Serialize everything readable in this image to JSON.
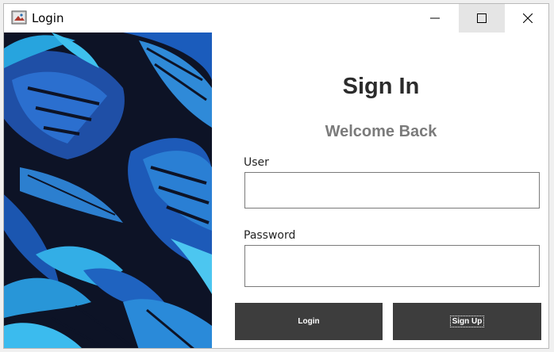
{
  "window": {
    "title": "Login",
    "icons": [
      "app-icon",
      "minimize-icon",
      "maximize-icon",
      "close-icon"
    ]
  },
  "form": {
    "heading": "Sign In",
    "subheading": "Welcome Back",
    "user_label": "User",
    "user_value": "",
    "password_label": "Password",
    "password_value": "",
    "login_button": "Login",
    "signup_button": "Sign Up"
  },
  "colors": {
    "button_bg": "#3d3d3d",
    "heading": "#2b2b2b",
    "subheading": "#7b7b7b",
    "image_bg": "#0d1326"
  }
}
